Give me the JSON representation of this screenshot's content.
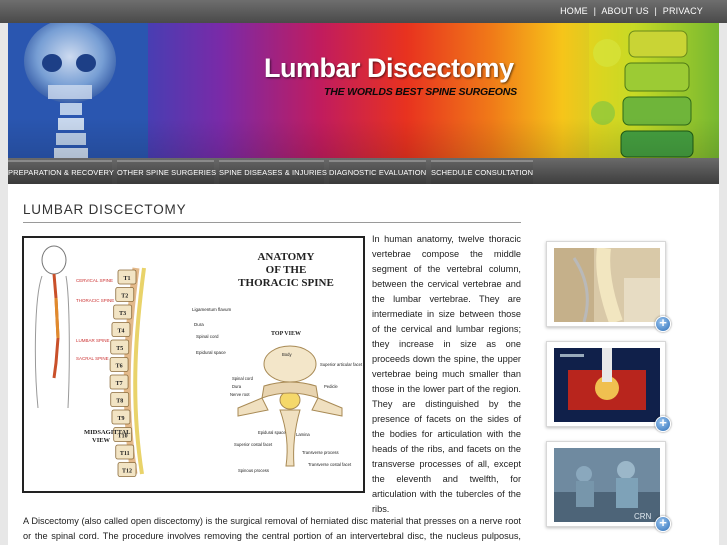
{
  "top_links": {
    "home": "HOME",
    "about": "ABOUT US",
    "privacy": "PRIVACY",
    "separator": "|"
  },
  "banner": {
    "title": "Lumbar Discectomy",
    "tagline": "THE WORLDS BEST SPINE SURGEONS"
  },
  "nav": [
    "PREPARATION & RECOVERY",
    "OTHER SPINE SURGERIES",
    "SPINE DISEASES & INJURIES",
    "DIAGNOSTIC EVALUATION",
    "SCHEDULE CONSULTATION"
  ],
  "main": {
    "heading": "LUMBAR DISCECTOMY",
    "figure": {
      "title_line1": "ANATOMY",
      "title_line2": "OF THE",
      "title_line3": "THORACIC SPINE",
      "top_view": "TOP VIEW",
      "midsagittal_line1": "MIDSAGITTAL",
      "midsagittal_line2": "VIEW",
      "side_labels": [
        "CERVICAL SPINE",
        "THORACIC SPINE",
        "LUMBAR SPINE",
        "SACRAL SPINE"
      ],
      "vertebrae": [
        "T1",
        "T2",
        "T3",
        "T4",
        "T5",
        "T6",
        "T7",
        "T8",
        "T9",
        "T10",
        "T11",
        "T12"
      ],
      "sagittal_labels": [
        "Ligamentum flavum",
        "Dura",
        "Spinal cord",
        "Epidural space"
      ],
      "top_labels": [
        "Spinal cord",
        "Dura",
        "Nerve root",
        "Body",
        "Superior articular facet",
        "Pedicle",
        "Epidural space",
        "Lamina",
        "Superior costal facet",
        "Transverse process",
        "Transverse costal facet",
        "Spinous process"
      ]
    },
    "body": "In human anatomy, twelve thoracic vertebrae compose the middle segment of the vertebral column, between the cervical vertebrae and the lumbar vertebrae. They are intermediate in size between those of the cervical and lumbar regions; they increase in size as one proceeds down the spine, the upper vertebrae being much smaller than those in the lower part of the region. They are distinguished by the presence of facets on the sides of the bodies for articulation with the heads of the ribs, and facets on the transverse processes of all, except the eleventh and twelfth, for articulation with the tubercles of the ribs.",
    "lower": "A Discectomy (also called open discectomy) is the surgical removal of herniated disc material that presses on a nerve root or the spinal cord. The procedure involves removing the central portion of an intervertebral disc, the nucleus pulposus, which causes"
  },
  "thumbnails": [
    {
      "icon": "plus-icon",
      "watermark": ""
    },
    {
      "icon": "plus-icon",
      "watermark": ""
    },
    {
      "icon": "plus-icon",
      "watermark": "CRN"
    }
  ],
  "colors": {
    "topbar": "#5a5a5a",
    "nav": "#4a4a4a",
    "accent": "#2d6fb8"
  }
}
